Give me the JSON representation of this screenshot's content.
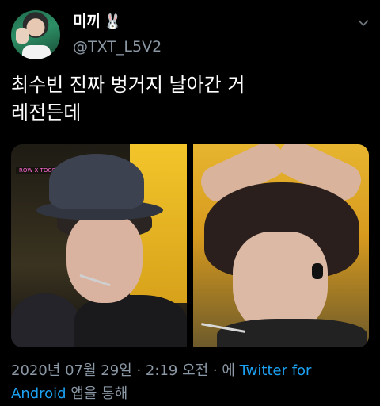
{
  "author": {
    "display_name": "미끼",
    "emoji": "🐰",
    "handle": "@TXT_L5V2"
  },
  "tweet": {
    "text_line1": "최수빈 진짜 벙거지 날아간 거",
    "text_line2": "레전든데"
  },
  "media": {
    "left_overlay_tag": "ROW X TOGETHER"
  },
  "meta": {
    "date": "2020년 07월 29일",
    "sep1": " · ",
    "time": "2:19 오전",
    "sep2": " · ",
    "via": "에 ",
    "client_line1": "Twitter for",
    "client_line2": "Android",
    "suffix": " 앱을 통해"
  },
  "colors": {
    "background": "#000000",
    "secondary_text": "#8b98a5",
    "link": "#1da1f2"
  },
  "icons": [
    "chevron-down-icon",
    "rabbit-icon"
  ]
}
